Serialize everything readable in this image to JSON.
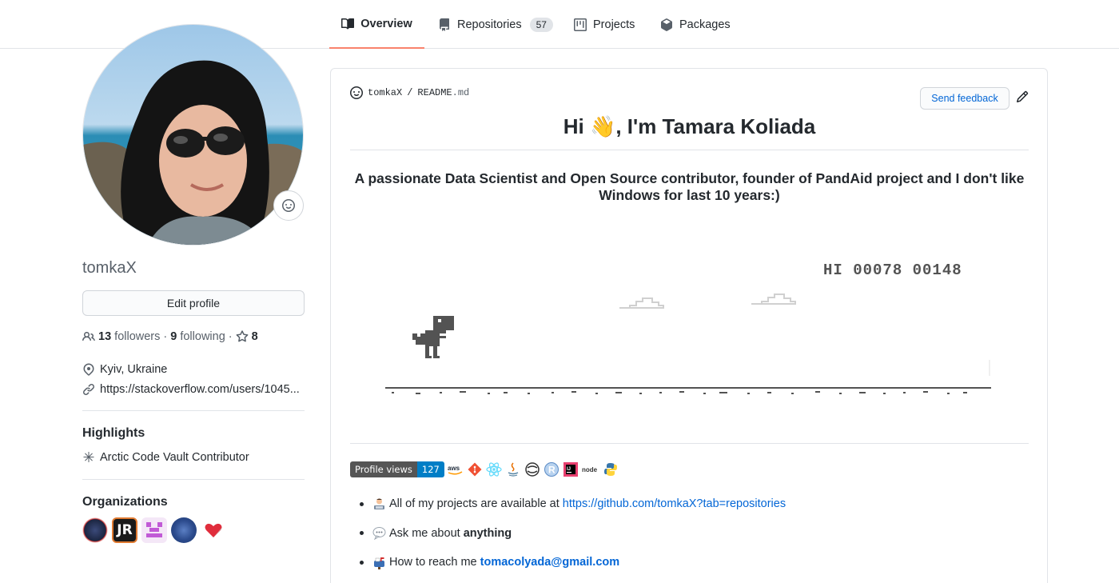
{
  "tabs": [
    {
      "label": "Overview",
      "icon": "book-icon",
      "active": true
    },
    {
      "label": "Repositories",
      "icon": "repo-icon",
      "count": "57"
    },
    {
      "label": "Projects",
      "icon": "project-icon"
    },
    {
      "label": "Packages",
      "icon": "package-icon"
    }
  ],
  "profile": {
    "username": "tomkaX",
    "edit_label": "Edit profile",
    "followers_count": "13",
    "followers_label": "followers",
    "following_count": "9",
    "following_label": "following",
    "stars_count": "8",
    "location": "Kyiv, Ukraine",
    "website": "https://stackoverflow.com/users/1045..."
  },
  "highlights": {
    "heading": "Highlights",
    "items": [
      "Arctic Code Vault Contributor"
    ]
  },
  "organizations": {
    "heading": "Organizations",
    "items": [
      "org-1",
      "org-JR",
      "org-3",
      "org-4",
      "org-5"
    ],
    "jr_text": "JR"
  },
  "readme": {
    "owner": "tomkaX",
    "separator": "/",
    "file_name": "README",
    "file_ext": ".md",
    "feedback_label": "Send feedback",
    "title": "Hi 👋, I'm Tamara Koliada",
    "subtitle_line1": "A passionate Data Scientist and Open Source contributor, founder of PandAid project and I don't like",
    "subtitle_line2": "Windows for last 10 years:)",
    "game_score": "HI 00078 00148",
    "profile_views_label": "Profile views",
    "profile_views_count": "127",
    "tech_icons": [
      "aws-icon",
      "git-icon",
      "react-icon",
      "java-icon",
      "jupyter-icon",
      "r-icon",
      "intellij-icon",
      "nodejs-icon",
      "python-icon"
    ],
    "bullets": [
      {
        "emoji": "🧑‍💻",
        "text": "All of my projects are available at ",
        "link": "https://github.com/tomkaX?tab=repositories"
      },
      {
        "emoji": "💬",
        "text": "Ask me about ",
        "bold": "anything"
      },
      {
        "emoji": "📫",
        "text": "How to reach me ",
        "link": "tomacolyada@gmail.com"
      }
    ]
  },
  "colors": {
    "accent_tab": "#f9826c",
    "link": "#0366d6",
    "text": "#24292e",
    "muted": "#586069",
    "border": "#e1e4e8"
  }
}
